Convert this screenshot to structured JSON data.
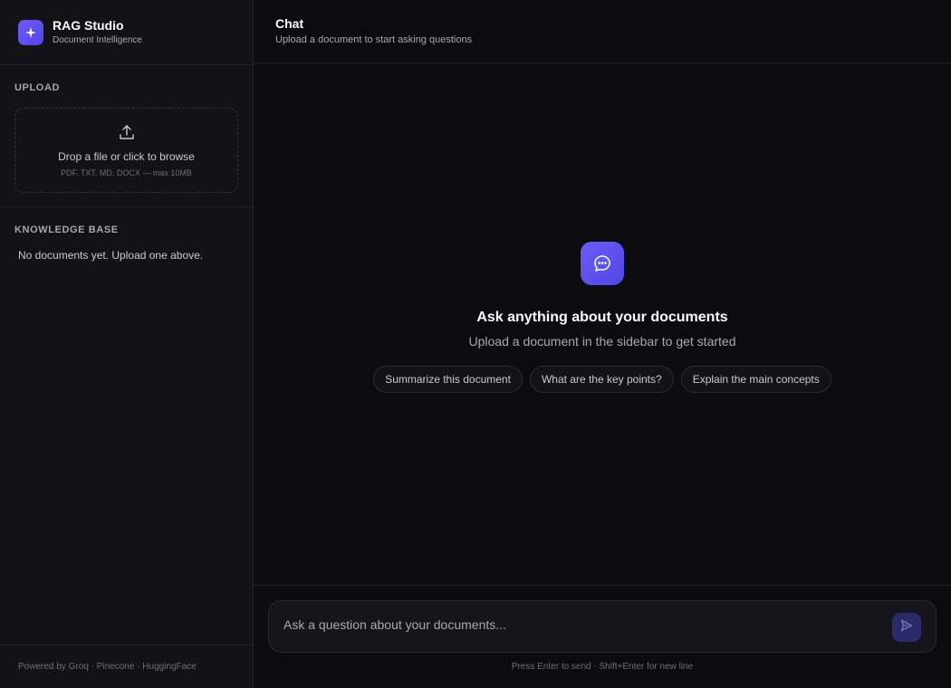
{
  "brand": {
    "title": "RAG Studio",
    "subtitle": "Document Intelligence",
    "icon": "sparkle-icon"
  },
  "upload": {
    "section_label": "UPLOAD",
    "dropzone_title": "Drop a file or click to browse",
    "dropzone_hint": "PDF, TXT, MD, DOCX — max 10MB",
    "icon": "upload-icon"
  },
  "knowledge_base": {
    "section_label": "KNOWLEDGE BASE",
    "empty_text": "No documents yet. Upload one above."
  },
  "footer": {
    "text": "Powered by Groq · Pinecone · HuggingFace"
  },
  "header": {
    "title": "Chat",
    "subtitle": "Upload a document to start asking questions"
  },
  "empty_state": {
    "icon": "chat-bubble-icon",
    "title": "Ask anything about your documents",
    "subtitle": "Upload a document in the sidebar to get started",
    "suggestions": [
      "Summarize this document",
      "What are the key points?",
      "Explain the main concepts"
    ]
  },
  "composer": {
    "placeholder": "Ask a question about your documents...",
    "value": "",
    "hint": "Press Enter to send · Shift+Enter for new line",
    "send_icon": "send-icon"
  },
  "colors": {
    "accent": "#5b4ff0",
    "background": "#0c0c10",
    "sidebar": "#121217"
  }
}
